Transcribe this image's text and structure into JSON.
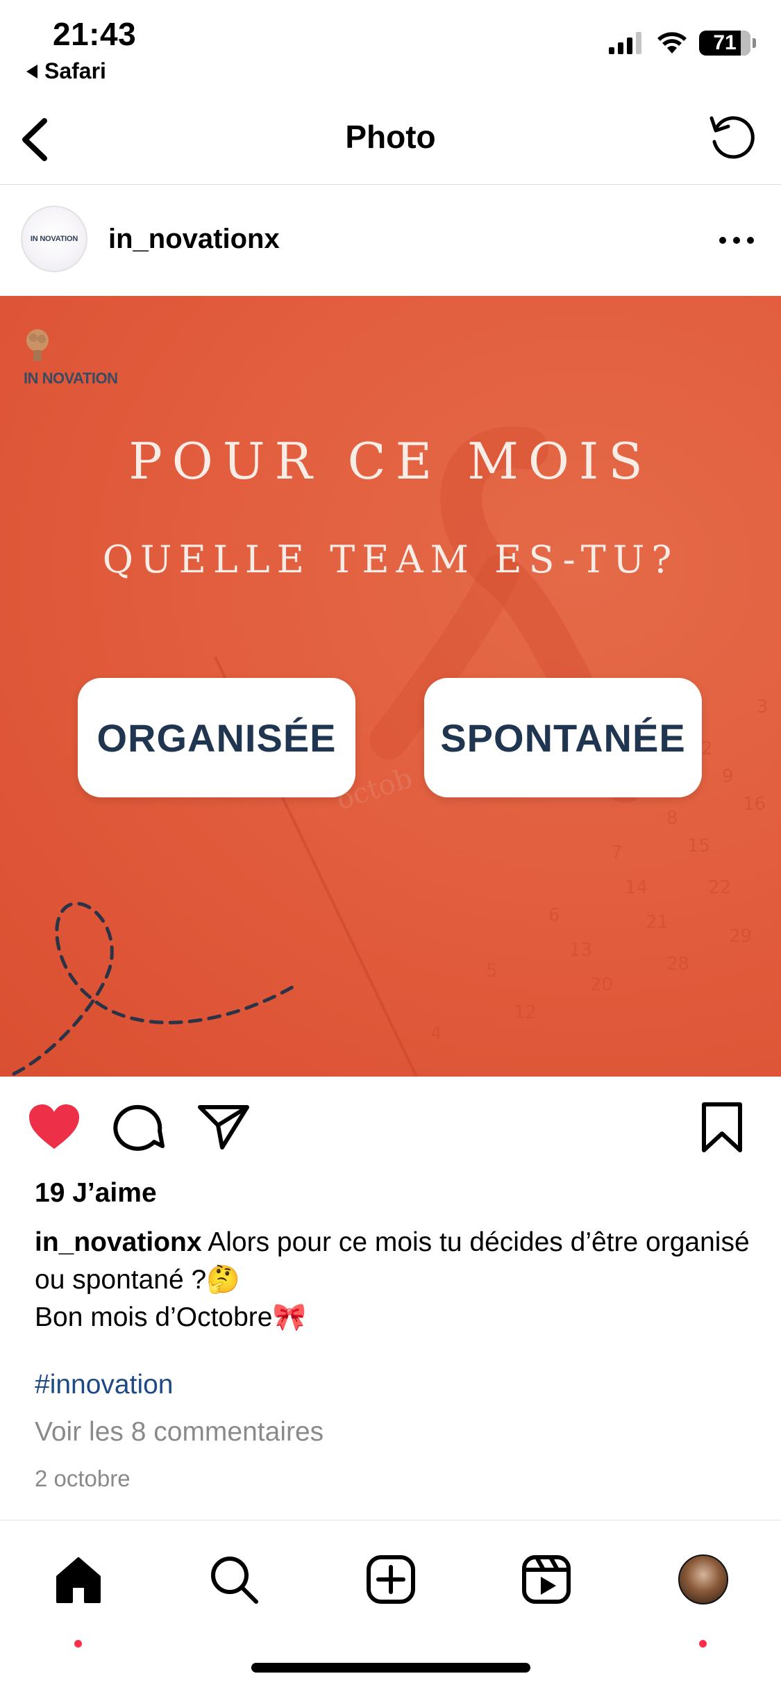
{
  "status_bar": {
    "time": "21:43",
    "back_app": "Safari",
    "battery": "71"
  },
  "header": {
    "title": "Photo"
  },
  "post": {
    "username": "in_novationx",
    "avatar_text": "IN NOVATION",
    "image": {
      "logo_text": "IN NOVATION",
      "headline_line1": "POUR CE MOIS",
      "headline_line2": "QUELLE TEAM ES-TU?",
      "option_left": "ORGANISÉE",
      "option_right": "SPONTANÉE",
      "background_color": "#E05A3C"
    },
    "likes": "19 J’aime",
    "caption_user": "in_novationx",
    "caption_line1": " Alors pour ce mois tu décides d’être organisé ou spontané ?🤔",
    "caption_line2": "Bon mois d’Octobre🎀",
    "hashtag": "#innovation",
    "comments_link": "Voir les 8 commentaires",
    "date": "2 octobre",
    "liked": true
  },
  "icons": {
    "back": "chevron-left-icon",
    "refresh": "refresh-icon",
    "more": "more-horizontal-icon",
    "like": "heart-icon",
    "comment": "comment-icon",
    "share": "send-icon",
    "save": "bookmark-icon"
  },
  "tab_bar": {
    "items": [
      "home",
      "search",
      "create",
      "reels",
      "profile"
    ]
  },
  "colors": {
    "like_red": "#ED2F47",
    "hashtag_blue": "#1D4A86",
    "notification_dot": "#FF2F4C",
    "button_text": "#1F3550"
  }
}
